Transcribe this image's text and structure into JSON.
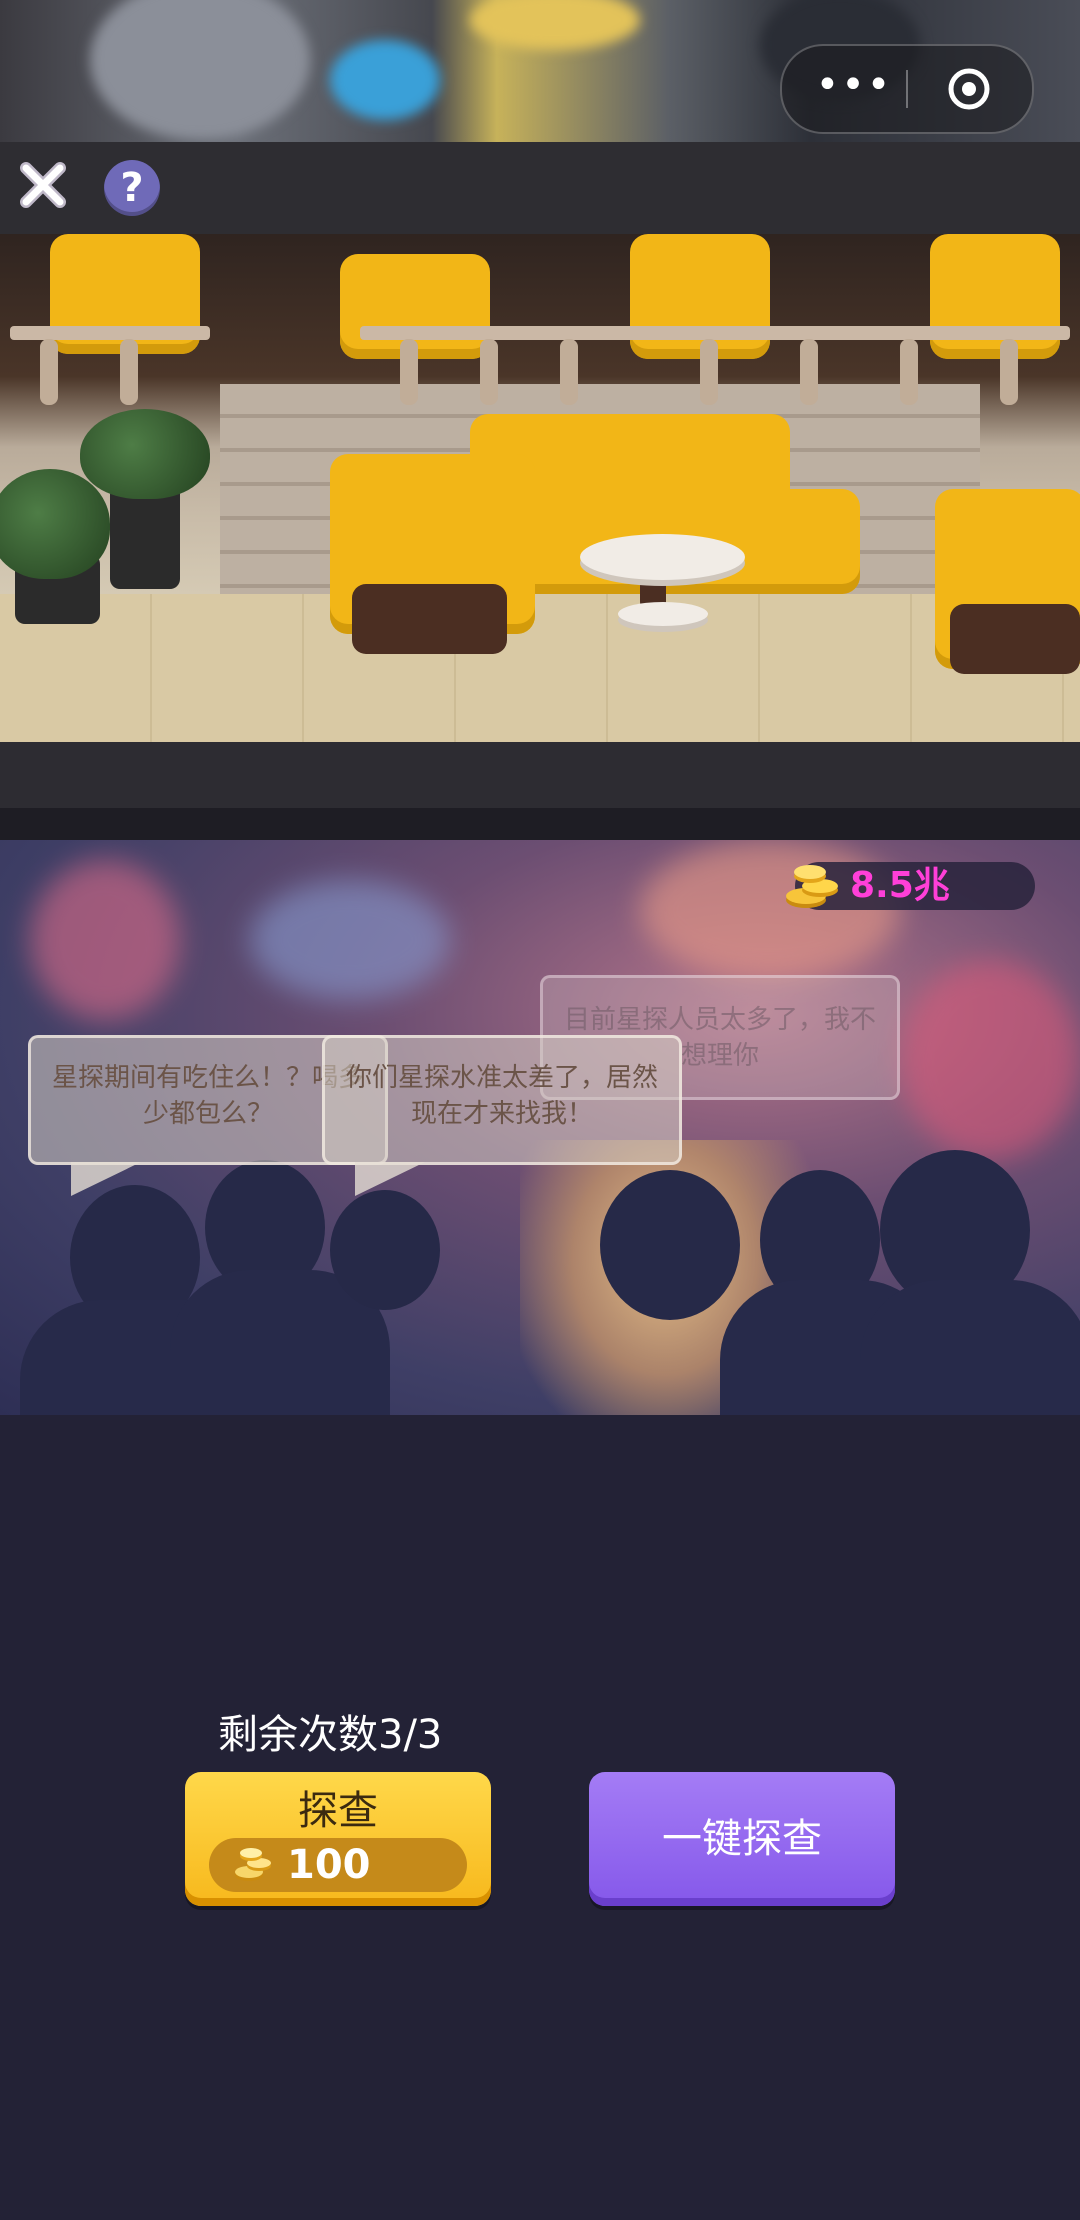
{
  "capsule": {
    "more_glyph": "•••"
  },
  "toolbar": {
    "help_glyph": "?"
  },
  "crowd": {
    "coins": "8.5兆",
    "bubbles": [
      {
        "text": "星探期间有吃住么！？喝多少都包么？"
      },
      {
        "text": "你们星探水准太差了，居然现在才来找我！"
      },
      {
        "text": "目前星探人员太多了，我不想理你"
      }
    ]
  },
  "controls": {
    "remaining": "剩余次数3/3",
    "probe_label": "探查",
    "probe_cost": "100",
    "one_key_label": "一键探查"
  },
  "colors": {
    "probe_button": "#f7b81c",
    "one_key_button": "#8a5cec",
    "coin_text": "#ff3fd8",
    "background": "#232236"
  }
}
